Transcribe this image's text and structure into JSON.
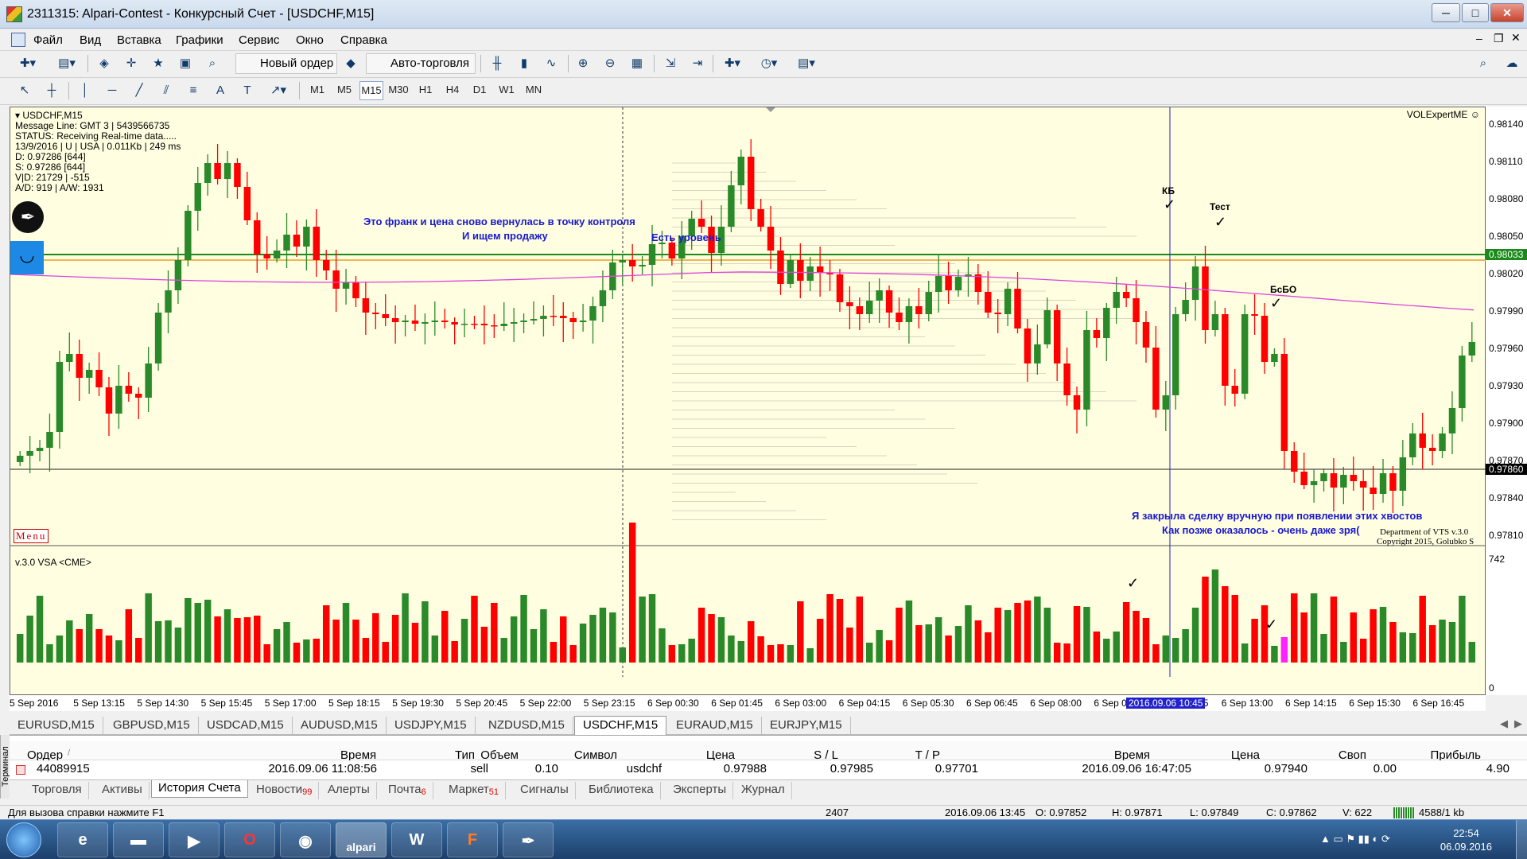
{
  "window": {
    "title": "2311315: Alpari-Contest - Конкурсный Счет - [USDCHF,M15]",
    "min": "─",
    "max": "□",
    "close": "✕"
  },
  "menu": [
    "Файл",
    "Вид",
    "Вставка",
    "Графики",
    "Сервис",
    "Окно",
    "Справка"
  ],
  "toolbar": {
    "new_order": "Новый ордер",
    "auto_trading": "Авто-торговля"
  },
  "timeframes": [
    "M1",
    "M5",
    "M15",
    "M30",
    "H1",
    "H4",
    "D1",
    "W1",
    "MN"
  ],
  "active_timeframe": "M15",
  "chart": {
    "symbol_label": "USDCHF,M15",
    "info_lines": [
      "Message Line: GMT 3 | 5439566735",
      "STATUS:  Receiving Real-time data.....",
      "13/9/2016 | U | USA | 0.011Kb | 249 ms",
      "D: 0.97286  [644]",
      "S: 0.97286  [644]",
      "V|D: 21729 | -515",
      "A/D: 919 | A/W: 1931"
    ],
    "ea_name": "VOLExpertME ☺",
    "menu_button": "Menu",
    "indicator_label": "v.3.0 VSA <CME>",
    "vol_max": "742",
    "vol_min": "0",
    "copyright_1": "Department of VTS  v.3.0",
    "copyright_2": "Copyright 2015, Golubko S",
    "annotations": {
      "franc": "Это франк и цена сново вернулась в точку контроля",
      "sell": "И ищем продажу",
      "level": "Есть уровень",
      "closed": "Я закрыла сделку вручную при появлении этих хвостов",
      "later": "Как позже оказалось - очень даже зря(",
      "kb": "КБ",
      "test": "Тест",
      "bsbo": "БсБО"
    },
    "price_labels": [
      "0.98140",
      "0.98110",
      "0.98080",
      "0.98050",
      "0.98020",
      "0.97990",
      "0.97960",
      "0.97930",
      "0.97900",
      "0.97870",
      "0.97840",
      "0.97810"
    ],
    "price_highlight_green": "0.98033",
    "price_highlight_black": "0.97860",
    "time_labels": [
      "5 Sep 2016",
      "5 Sep 13:15",
      "5 Sep 14:30",
      "5 Sep 15:45",
      "5 Sep 17:00",
      "5 Sep 18:15",
      "5 Sep 19:30",
      "5 Sep 20:45",
      "5 Sep 22:00",
      "5 Sep 23:15",
      "6 Sep 00:30",
      "6 Sep 01:45",
      "6 Sep 03:00",
      "6 Sep 04:15",
      "6 Sep 05:30",
      "6 Sep 06:45",
      "6 Sep 08:00",
      "6 Sep 0",
      "6 Sep 11:45",
      "6 Sep 13:00",
      "6 Sep 14:15",
      "6 Sep 15:30",
      "6 Sep 16:45"
    ],
    "time_cursor": "2016.09.06 10:45",
    "colors": {
      "bull": "#2a8a2a",
      "bear": "#ff0000",
      "ma": "#dd44dd",
      "cursor": "#2222cc",
      "volume_special": "#ff22ff"
    }
  },
  "symbol_tabs": [
    "EURUSD,M15",
    "GBPUSD,M15",
    "USDCAD,M15",
    "AUDUSD,M15",
    "USDJPY,M15",
    "NZDUSD,M15",
    "USDCHF,M15",
    "EURAUD,M15",
    "EURJPY,M15"
  ],
  "active_symbol_tab": "USDCHF,M15",
  "terminal": {
    "side_label": "Терминал",
    "columns": [
      "Ордер",
      "/",
      "Время",
      "Тип",
      "Объем",
      "Символ",
      "Цена",
      "S / L",
      "T / P",
      "Время",
      "Цена",
      "Своп",
      "Прибыль"
    ],
    "rows": [
      [
        "44089915",
        "2016.09.06 11:08:56",
        "sell",
        "0.10",
        "usdchf",
        "0.97988",
        "0.97985",
        "0.97701",
        "2016.09.06 16:47:05",
        "0.97940",
        "0.00",
        "4.90"
      ]
    ],
    "tabs": [
      {
        "label": "Торговля",
        "count": ""
      },
      {
        "label": "Активы",
        "count": ""
      },
      {
        "label": "История Счета",
        "count": ""
      },
      {
        "label": "Новости",
        "count": "99"
      },
      {
        "label": "Алерты",
        "count": ""
      },
      {
        "label": "Почта",
        "count": "6"
      },
      {
        "label": "Маркет",
        "count": "51"
      },
      {
        "label": "Сигналы",
        "count": ""
      },
      {
        "label": "Библиотека",
        "count": ""
      },
      {
        "label": "Эксперты",
        "count": ""
      },
      {
        "label": "Журнал",
        "count": ""
      }
    ],
    "active_tab": "История Счета"
  },
  "status": {
    "help": "Для вызова справки нажмите F1",
    "bars": "2407",
    "time": "2016.09.06 13:45",
    "open": "O: 0.97852",
    "high": "H: 0.97871",
    "low": "L: 0.97849",
    "close": "C: 0.97862",
    "volume": "V: 622",
    "traffic": "4588/1 kb"
  },
  "taskbar": {
    "time": "22:54",
    "date": "06.09.2016"
  }
}
